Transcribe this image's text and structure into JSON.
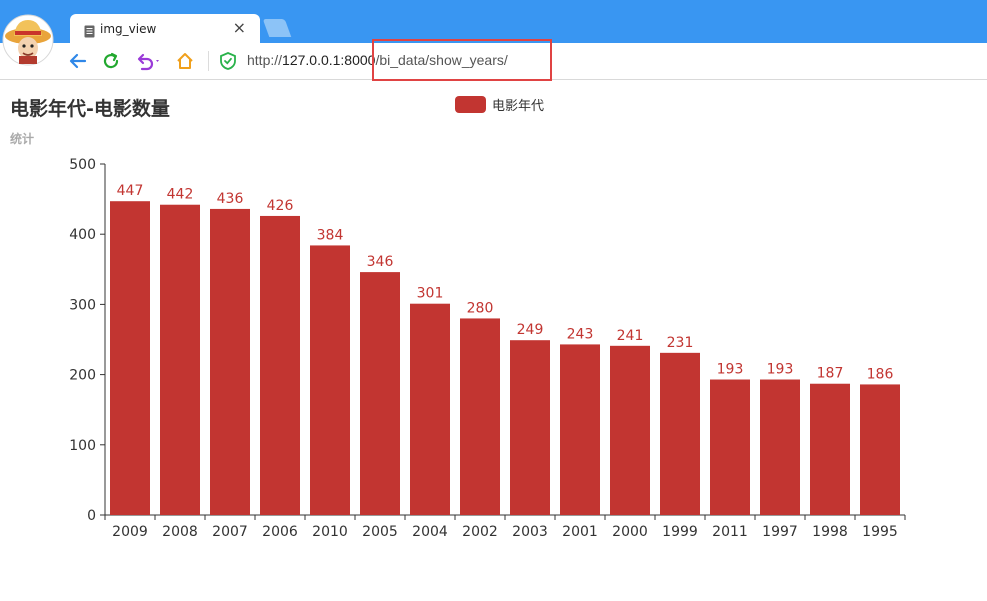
{
  "browser": {
    "tab_title": "img_view",
    "tab_close": "×",
    "url_prefix": "http://",
    "url_host": "127.0.0.1:8000",
    "url_path": "/bi_data/show_years/",
    "accent_color": "#3996f2"
  },
  "chart_data": {
    "type": "bar",
    "title": "电影年代-电影数量",
    "subtitle": "统计",
    "legend": [
      "电影年代"
    ],
    "legend_position": "top-center",
    "categories": [
      "2009",
      "2008",
      "2007",
      "2006",
      "2010",
      "2005",
      "2004",
      "2002",
      "2003",
      "2001",
      "2000",
      "1999",
      "2011",
      "1997",
      "1998",
      "1995"
    ],
    "series": [
      {
        "name": "电影年代",
        "values": [
          447,
          442,
          436,
          426,
          384,
          346,
          301,
          280,
          249,
          243,
          241,
          231,
          193,
          193,
          187,
          186
        ],
        "color": "#c23531"
      }
    ],
    "y_ticks": [
      0,
      100,
      200,
      300,
      400,
      500
    ],
    "ylim": [
      0,
      500
    ],
    "grid": false,
    "data_labels": true
  }
}
